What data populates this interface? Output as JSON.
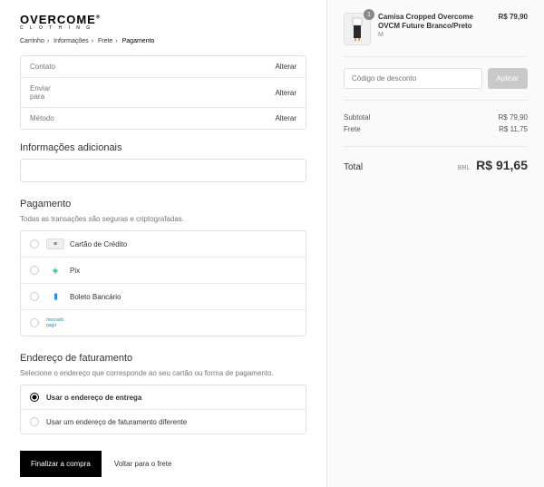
{
  "logo": {
    "main": "OVERCOME",
    "sub": "C L O T H I N G"
  },
  "breadcrumb": {
    "items": [
      "Carrinho",
      "Informações",
      "Frete",
      "Pagamento"
    ]
  },
  "review": {
    "contact": {
      "label": "Contato",
      "value": "",
      "change": "Alterar"
    },
    "ship": {
      "label": "Enviar para",
      "value": "",
      "change": "Alterar"
    },
    "method": {
      "label": "Método",
      "value": "",
      "change": "Alterar"
    }
  },
  "additional": {
    "title": "Informações adicionais"
  },
  "payment": {
    "title": "Pagamento",
    "subtitle": "Todas as transações são seguras e criptografadas.",
    "methods": {
      "cc": "Cartão de Crédito",
      "pix": "Pix",
      "boleto": "Boleto Bancário",
      "mp": "mercado pago"
    }
  },
  "billing": {
    "title": "Endereço de faturamento",
    "subtitle": "Selecione o endereço que corresponde ao seu cartão ou forma de pagamento.",
    "same": "Usar o endereço de entrega",
    "diff": "Usar um endereço de faturamento diferente"
  },
  "actions": {
    "complete": "Finalizar a compra",
    "back": "Voltar para o frete"
  },
  "cart": {
    "item": {
      "name": "Camisa Cropped Overcome OVCM Future Branco/Preto",
      "variant": "M",
      "qty": "1",
      "price": "R$ 79,90"
    }
  },
  "discount": {
    "placeholder": "Código de desconto",
    "apply": "Aplicar"
  },
  "totals": {
    "subtotal": {
      "label": "Subtotal",
      "value": "R$ 79,90"
    },
    "shipping": {
      "label": "Frete",
      "value": "R$ 11,75"
    }
  },
  "grand": {
    "label": "Total",
    "currency": "BRL",
    "amount": "R$ 91,65"
  }
}
